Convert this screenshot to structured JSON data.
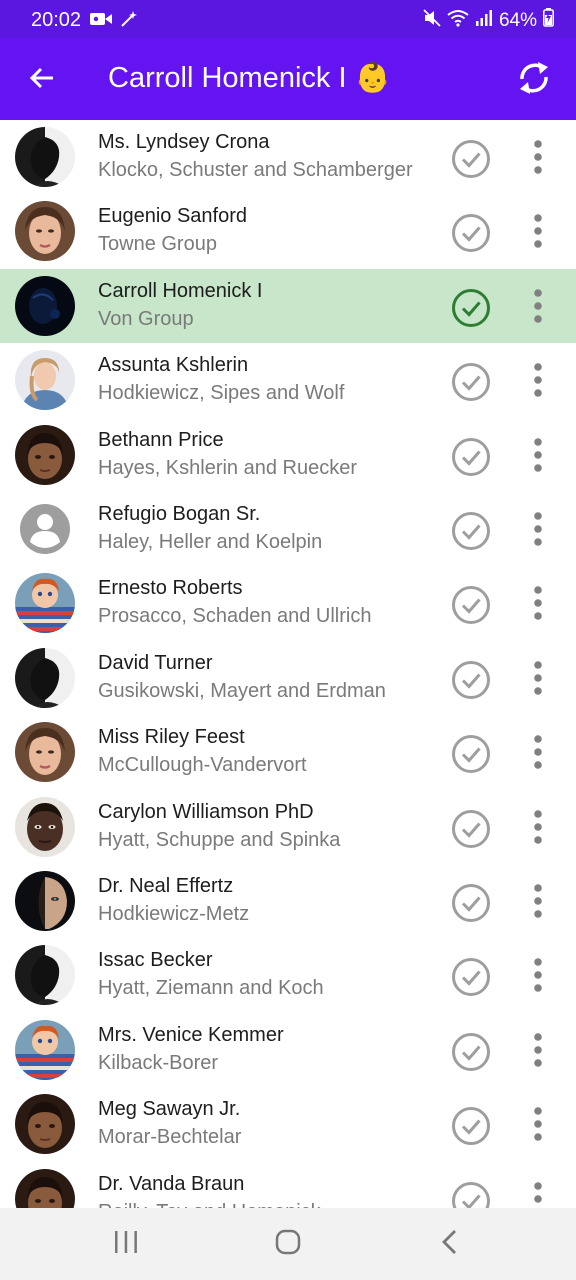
{
  "status_bar": {
    "time": "20:02",
    "battery": "64%",
    "icons": [
      "video-camera-icon",
      "magic-wand-icon",
      "mute-icon",
      "wifi-icon",
      "signal-icon",
      "battery-charging-icon"
    ]
  },
  "app_bar": {
    "title": "Carroll Homenick I 👶",
    "back_icon": "arrow-back-icon",
    "refresh_icon": "refresh-icon"
  },
  "colors": {
    "accent": "#6414f0",
    "selected_row": "#c8e6c9",
    "check_selected": "#2e7d32",
    "check_default": "#9e9e9e"
  },
  "contacts": [
    {
      "name": "Ms. Lyndsey Crona",
      "company": "Klocko, Schuster and Schamberger",
      "selected": false,
      "avatar": "dark-profile-photo"
    },
    {
      "name": "Eugenio Sanford",
      "company": "Towne Group",
      "selected": false,
      "avatar": "woman-portrait-photo"
    },
    {
      "name": "Carroll Homenick I",
      "company": "Von Group",
      "selected": true,
      "avatar": "dark-blue-photo"
    },
    {
      "name": "Assunta Kshlerin",
      "company": "Hodkiewicz, Sipes and Wolf",
      "selected": false,
      "avatar": "woman-denim-photo"
    },
    {
      "name": "Bethann Price",
      "company": "Hayes, Kshlerin and Ruecker",
      "selected": false,
      "avatar": "child-portrait-photo"
    },
    {
      "name": "Refugio Bogan Sr.",
      "company": "Haley, Heller and Koelpin",
      "selected": false,
      "avatar": "default-person-icon"
    },
    {
      "name": "Ernesto Roberts",
      "company": "Prosacco, Schaden and Ullrich",
      "selected": false,
      "avatar": "doll-striped-photo"
    },
    {
      "name": "David Turner",
      "company": "Gusikowski, Mayert and Erdman",
      "selected": false,
      "avatar": "dark-profile-photo"
    },
    {
      "name": "Miss Riley Feest",
      "company": "McCullough-Vandervort",
      "selected": false,
      "avatar": "woman-portrait-photo"
    },
    {
      "name": "Carylon Williamson PhD",
      "company": "Hyatt, Schuppe and Spinka",
      "selected": false,
      "avatar": "man-portrait-photo"
    },
    {
      "name": "Dr. Neal Effertz",
      "company": "Hodkiewicz-Metz",
      "selected": false,
      "avatar": "half-face-photo"
    },
    {
      "name": "Issac Becker",
      "company": "Hyatt, Ziemann and Koch",
      "selected": false,
      "avatar": "dark-profile-photo"
    },
    {
      "name": "Mrs. Venice Kemmer",
      "company": "Kilback-Borer",
      "selected": false,
      "avatar": "doll-striped-photo"
    },
    {
      "name": "Meg Sawayn Jr.",
      "company": "Morar-Bechtelar",
      "selected": false,
      "avatar": "child-portrait-photo"
    },
    {
      "name": "Dr. Vanda Braun",
      "company": "Reilly, Toy and Homenick",
      "selected": false,
      "avatar": "child-portrait-photo"
    }
  ],
  "nav_bar": {
    "icons": [
      "recent-apps-icon",
      "home-icon",
      "back-icon"
    ]
  }
}
